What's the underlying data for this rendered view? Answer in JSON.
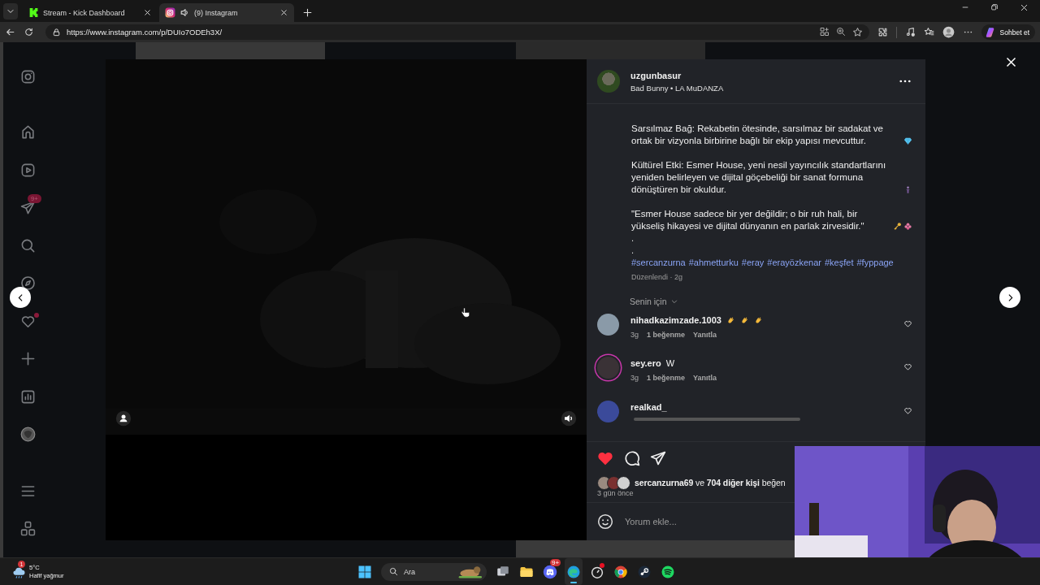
{
  "browser": {
    "tabs": [
      {
        "title": "Stream - Kick Dashboard",
        "kind": "kick",
        "selected": false,
        "audio": false
      },
      {
        "title": "(9) Instagram",
        "kind": "instagram",
        "selected": true,
        "audio": true
      }
    ],
    "url": "https://www.instagram.com/p/DUIo7ODEh3X/",
    "copilot_label": "Sohbet et"
  },
  "sidebar": {
    "top": [
      {
        "kind": "logo"
      }
    ],
    "main": [
      {
        "kind": "home"
      },
      {
        "kind": "reels"
      },
      {
        "kind": "messages",
        "badge": "9+"
      },
      {
        "kind": "search"
      },
      {
        "kind": "explore"
      },
      {
        "kind": "notifications",
        "dot": true
      },
      {
        "kind": "create"
      },
      {
        "kind": "dashboard"
      },
      {
        "kind": "profile"
      }
    ],
    "bottom": [
      {
        "kind": "menu"
      },
      {
        "kind": "apps"
      }
    ]
  },
  "post": {
    "video": {
      "kind": "picture"
    },
    "username": "uzgunbasur",
    "music": "Bad Bunny • LA MuDANZA",
    "caption": [
      {
        "text": "Sarsılmaz Bağ: Rekabetin ötesinde, sarsılmaz bir sadakat ve ortak bir vizyonla birbirine bağlı bir ekip yapısı mevcuttur.",
        "emoji": [
          {
            "kind": "gem"
          }
        ]
      },
      {
        "text": "Kültürel Etki: Esmer House, yeni nesil yayıncılık standartlarını yeniden belirleyen ve dijital göçebeliği bir sanat formuna dönüştüren bir okuldur.",
        "emoji": [
          {
            "kind": "figure"
          }
        ]
      },
      {
        "text": "\"Esmer House sadece bir yer değildir; o bir ruh hali, bir yükseliş hikayesi ve dijital dünyanın en parlak zirvesidir.\"",
        "emoji": [
          {
            "kind": "key"
          },
          {
            "kind": "blossom"
          }
        ]
      }
    ],
    "dots": [
      ".",
      "."
    ],
    "hashtags": [
      "#sercanzurna",
      "#ahmetturku",
      "#eray",
      "#erayözkenar",
      "#keşfet",
      "#fyppage"
    ],
    "edited": "Düzenlendi · 2g",
    "sort_label": "Senin için",
    "comments": [
      {
        "user": "nihadkazimzade.1003",
        "emoji": [
          {
            "kind": "clap"
          },
          {
            "kind": "clap"
          },
          {
            "kind": "clap"
          }
        ],
        "story_ring": false,
        "time": "3g",
        "likes": "1 beğenme",
        "reply": "Yanıtla"
      },
      {
        "user": "sey.ero",
        "text": "W",
        "story_ring": true,
        "time": "3g",
        "likes": "1 beğenme",
        "reply": "Yanıtla"
      },
      {
        "user": "realkad_",
        "story_ring": false
      }
    ],
    "liked": true,
    "likes_text": "**sercanzurna69** ve **704 diğer kişi** beğen",
    "date": "3 gün önce",
    "comment_placeholder": "Yorum ekle..."
  },
  "webcam": {
    "kind": "picture"
  },
  "taskbar": {
    "weather": {
      "badge": "1",
      "temp": "5°C",
      "desc": "Hafif yağmur"
    },
    "search_placeholder": "Ara",
    "apps": [
      {
        "kind": "taskview"
      },
      {
        "kind": "folder"
      },
      {
        "kind": "discord",
        "badge": "9+"
      },
      {
        "kind": "edge",
        "active": true
      },
      {
        "kind": "clock",
        "dot": true
      },
      {
        "kind": "chrome"
      },
      {
        "kind": "steam"
      },
      {
        "kind": "spotify"
      }
    ]
  }
}
